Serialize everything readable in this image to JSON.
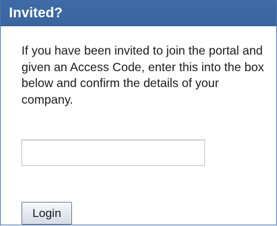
{
  "panel": {
    "title": "Invited?",
    "intro": "If you have been invited to join the portal and given an Access Code, enter this into the box below and confirm the details of your company.",
    "access_code": {
      "value": "",
      "placeholder": ""
    },
    "login_label": "Login"
  },
  "colors": {
    "header_bg": "#3f6ba6",
    "header_text": "#ffffff",
    "border": "#4a77b0",
    "body_text": "#1a1a1a"
  }
}
